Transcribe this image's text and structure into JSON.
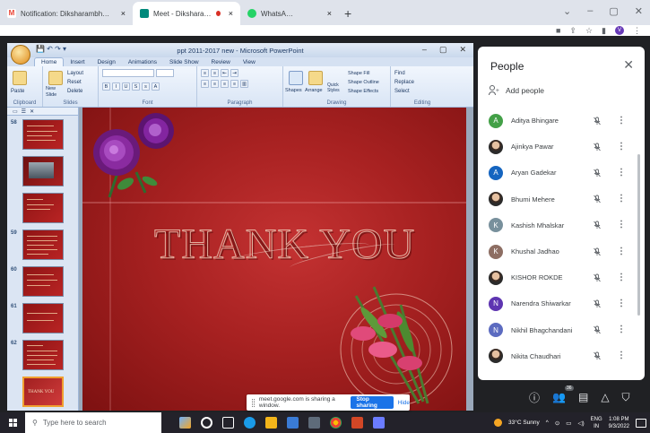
{
  "browser": {
    "tabs": [
      {
        "title": "Notification: Diksharambha @ Sc",
        "favicon_color": "#ea4335",
        "favicon_letter": "M",
        "active": false
      },
      {
        "title": "Meet - Diksharambha",
        "favicon_color": "#00897b",
        "active": true
      },
      {
        "title": "WhatsApp Web",
        "favicon_color": "#25d366",
        "active": false
      }
    ],
    "new_tab_glyph": "+",
    "close_glyph": "×"
  },
  "ppt": {
    "window_title": "ppt 2011-2017 new - Microsoft PowerPoint",
    "ribbon_tabs": [
      "Home",
      "Insert",
      "Design",
      "Animations",
      "Slide Show",
      "Review",
      "View"
    ],
    "groups": {
      "clipboard": {
        "label": "Clipboard",
        "paste": "Paste"
      },
      "slides": {
        "label": "Slides",
        "new_slide": "New Slide",
        "layout": "Layout",
        "reset": "Reset",
        "delete": "Delete"
      },
      "font": {
        "label": "Font"
      },
      "paragraph": {
        "label": "Paragraph"
      },
      "drawing": {
        "label": "Drawing",
        "shapes": "Shapes",
        "arrange": "Arrange",
        "quick_styles": "Quick Styles",
        "shape_fill": "Shape Fill",
        "shape_outline": "Shape Outline",
        "shape_effects": "Shape Effects"
      },
      "editing": {
        "label": "Editing",
        "find": "Find",
        "replace": "Replace",
        "select": "Select"
      }
    },
    "thumb_numbers": [
      "58",
      "",
      "",
      "59",
      "60",
      "61",
      "62",
      ""
    ],
    "slide_text": "THANK YOU"
  },
  "share_banner": {
    "text": "meet.google.com is sharing a window.",
    "stop": "Stop sharing",
    "hide": "Hide"
  },
  "people": {
    "title": "People",
    "add_label": "Add people",
    "participants": [
      {
        "name": "Aditya Bhingare",
        "initial": "A",
        "color": "#43a047"
      },
      {
        "name": "Ajinkya Pawar",
        "initial": "",
        "color": "#444444",
        "photo": true
      },
      {
        "name": "Aryan Gadekar",
        "initial": "A",
        "color": "#1565c0"
      },
      {
        "name": "Bhumi Mehere",
        "initial": "",
        "color": "#d7a08a",
        "photo": true
      },
      {
        "name": "Kashish Mhalskar",
        "initial": "K",
        "color": "#78909c"
      },
      {
        "name": "Khushal Jadhao",
        "initial": "K",
        "color": "#8d6e63"
      },
      {
        "name": "KISHOR ROKDE",
        "initial": "",
        "color": "#b07050",
        "photo": true
      },
      {
        "name": "Narendra Shiwarkar",
        "initial": "N",
        "color": "#5e35b1"
      },
      {
        "name": "Nikhil Bhagchandani",
        "initial": "N",
        "color": "#5c6bc0"
      },
      {
        "name": "Nikita Chaudhari",
        "initial": "",
        "color": "#333333",
        "photo": true
      }
    ]
  },
  "meet_controls": {
    "participant_badge": "36"
  },
  "taskbar": {
    "search_placeholder": "Type here to search",
    "weather": "33°C  Sunny",
    "lang": "ENG",
    "region": "IN",
    "time": "1:08 PM",
    "date": "9/3/2022"
  }
}
